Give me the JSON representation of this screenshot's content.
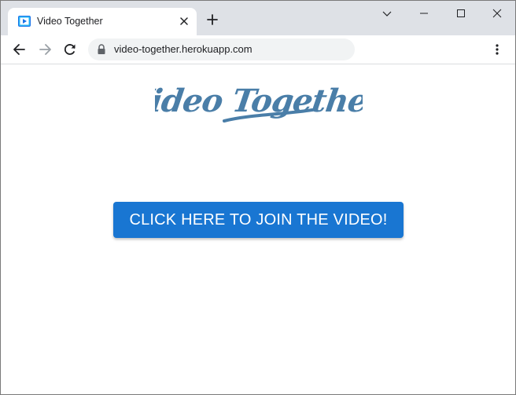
{
  "browser": {
    "tab": {
      "title": "Video Together",
      "favicon": "video-play-icon"
    },
    "toolbar": {
      "url": "video-together.herokuapp.com",
      "back_icon": "back-arrow-icon",
      "forward_icon": "forward-arrow-icon",
      "reload_icon": "reload-icon",
      "lock_icon": "lock-icon",
      "menu_icon": "kebab-menu-icon"
    },
    "window_controls": [
      "chevron-down-icon",
      "minimize-icon",
      "maximize-icon",
      "close-icon"
    ]
  },
  "page": {
    "logo_text": "Video Together",
    "join_button_label": "CLICK HERE TO JOIN THE VIDEO!"
  },
  "colors": {
    "button_bg": "#1976d2",
    "logo": "#4a7ea8",
    "tab_strip": "#dee1e6",
    "favicon": "#1a73e8"
  }
}
